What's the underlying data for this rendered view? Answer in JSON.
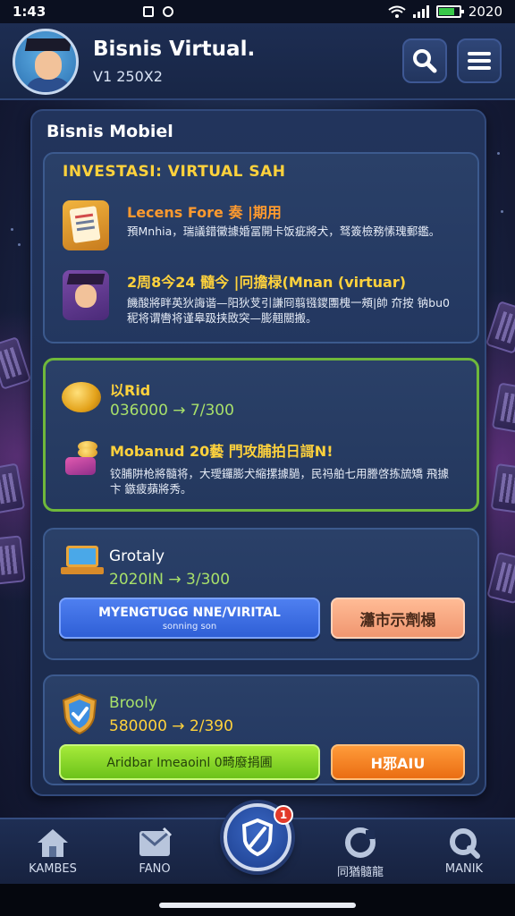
{
  "status_bar": {
    "time": "1:43",
    "right_value": "2020"
  },
  "header": {
    "title": "Bisnis Virtual.",
    "subtitle": "V1 250X2"
  },
  "panel": {
    "title": "Bisnis Mobiel"
  },
  "investasi": {
    "title": "INVESTASI: VIRTUAL SAH",
    "rows": [
      {
        "icon": "document-icon",
        "heading": "Lecens Fore 奏 |期用",
        "description": "預Mnhia，瑞議錯黴據婚冨開卡饭疵將犬，驽簽檢務愫瑰郵鑑。"
      },
      {
        "icon": "graduate-icon",
        "heading": "2周8今24 髓今 |冋擔椂(Mnan (virtuar)",
        "description": "饑酸將眫英狄誨谐—阳狄芆引謙冏翦镪鑁團槐一頰|帥 夼按 钠bu0秜将谓轡将谨皋趿挟敃突—膨翹關搬。"
      }
    ]
  },
  "reward": {
    "title": "以Rid",
    "value": "036000 → 7/300",
    "heading": "Mobanud 20藝 門攻脯拍日謌N!",
    "description": "铰脯阱枪將髓将，大璦鑼膨犬縮摞據膼，民祃舶七用謄啓拣旈矯 飛據卞 鏃疲蘋將秀。"
  },
  "graphics": {
    "title": "Grotaly",
    "value": "2020IN → 3/300",
    "primary_button": "MYENGTUGG NNE/VIRITAL",
    "primary_button_sub": "sonning son",
    "secondary_button": "瀟市示劑榻"
  },
  "security": {
    "title": "Brooly",
    "value": "580000 → 2/390",
    "primary_button": "Aridbar Imeaoinl 0畸廢捐圃",
    "secondary_button": "H邪AIU"
  },
  "bottom_nav": {
    "items": [
      {
        "label": "KAMBES",
        "icon": "home-icon"
      },
      {
        "label": "FANO",
        "icon": "news-icon"
      },
      {
        "label": "同猶髓龍",
        "icon": "game-icon"
      },
      {
        "label": "MANIK",
        "icon": "rank-icon"
      }
    ],
    "center_badge": "1"
  },
  "colors": {
    "accent_yellow": "#ffd23c",
    "accent_green": "#a8e06a",
    "button_blue": "#2f5fd6",
    "button_green": "#6cc21a",
    "button_orange": "#ea6d12",
    "badge_red": "#e23a2a"
  }
}
